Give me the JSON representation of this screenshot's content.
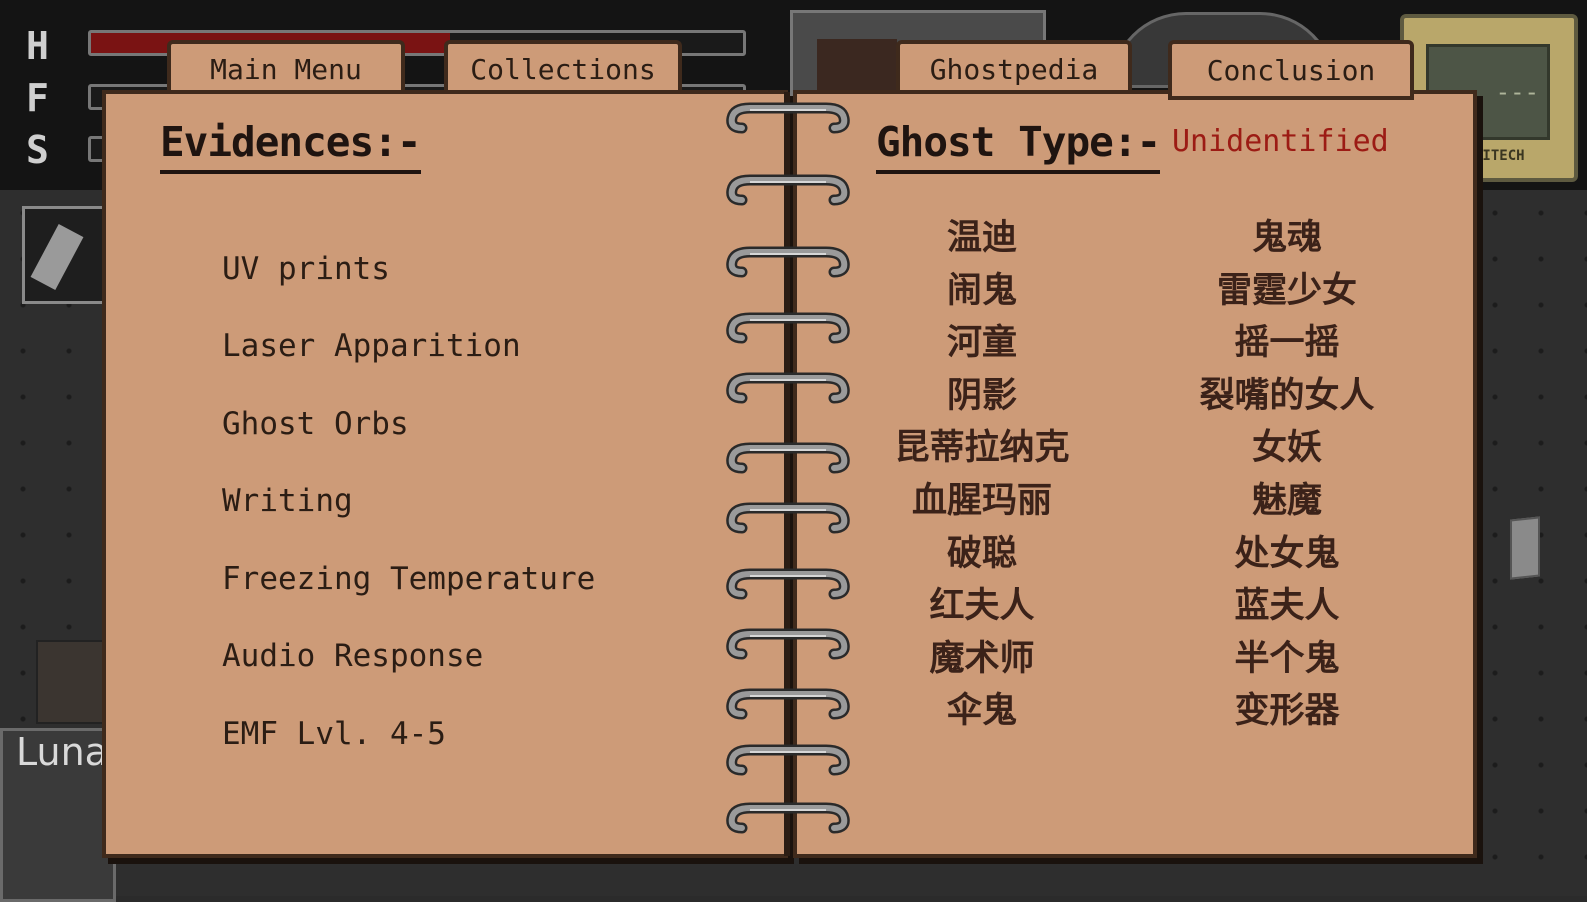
{
  "hud": {
    "stat_letters": [
      "H",
      "F",
      "S"
    ],
    "health_fraction": 0.55
  },
  "background": {
    "player_name": "Luna",
    "device_screen": "---",
    "device_label": "EITECH"
  },
  "tabs": {
    "main_menu": "Main Menu",
    "collections": "Collections",
    "ghostpedia": "Ghostpedia",
    "conclusion": "Conclusion"
  },
  "left_page": {
    "heading": "Evidences:-",
    "evidences": [
      "UV prints",
      "Laser Apparition",
      "Ghost Orbs",
      "Writing",
      "Freezing Temperature",
      "Audio Response",
      "EMF Lvl. 4-5"
    ]
  },
  "right_page": {
    "heading": "Ghost Type:-",
    "status": "Unidentified",
    "status_color": "#9c1b14",
    "ghosts_column_1": [
      "温迪",
      "闹鬼",
      "河童",
      "阴影",
      "昆蒂拉纳克",
      "血腥玛丽",
      "破聪",
      "红夫人",
      "魔术师",
      "伞鬼"
    ],
    "ghosts_column_2": [
      "鬼魂",
      "雷霆少女",
      "摇一摇",
      "裂嘴的女人",
      "女妖",
      "魅魔",
      "处女鬼",
      "蓝夫人",
      "半个鬼",
      "变形器"
    ]
  },
  "colors": {
    "paper": "#cd9b78",
    "ink": "#2b1d14",
    "border": "#3f2a1c"
  }
}
